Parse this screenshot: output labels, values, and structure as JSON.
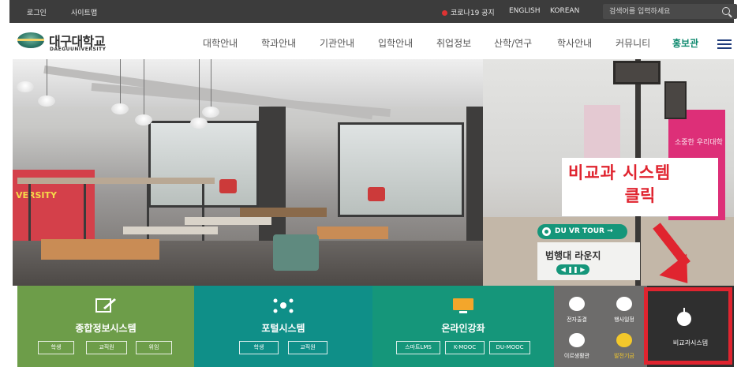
{
  "topbar": {
    "login": "로그인",
    "sitemap": "사이트맵",
    "covid_notice": "코로나19 공지",
    "lang_en": "ENGLISH",
    "lang_kr": "KOREAN",
    "search_placeholder": "검색어를 입력하세요"
  },
  "header": {
    "logo_kr": "대구대학교",
    "logo_en": "DAEGUUNIVERSITY",
    "menu": [
      "대학안내",
      "학과안내",
      "기관안내",
      "입학안내",
      "취업정보",
      "산학/연구",
      "학사안내",
      "커뮤니티",
      "홍보관"
    ]
  },
  "hero": {
    "wall_text": "VERSITY",
    "banner_text": "소중한 우리대학",
    "annotation_line1": "비교과 시스템",
    "annotation_line2": "클릭",
    "vr_badge": "DU VR TOUR →",
    "place_name": "법행대 라운지",
    "pager": "◀ ❚❚ ▶"
  },
  "quicklinks": {
    "tile1": {
      "title": "종합정보시스템",
      "buttons": [
        "학생",
        "교직원",
        "위임"
      ]
    },
    "tile2": {
      "title": "포털시스템",
      "buttons": [
        "학생",
        "교직원"
      ]
    },
    "tile3": {
      "title": "온라인강좌",
      "buttons": [
        "스마트LMS",
        "K-MOOC",
        "DU-MOOC"
      ]
    },
    "tile4": {
      "items": [
        "전자출결",
        "행사일정",
        "이르생활관",
        "발전기금"
      ]
    },
    "tile5": {
      "label": "비교과시스템"
    }
  },
  "colors": {
    "accent_green": "#15967a",
    "annotation_red": "#e0242f",
    "tile_green": "#6d9d49",
    "tile_teal": "#0f8f88"
  }
}
